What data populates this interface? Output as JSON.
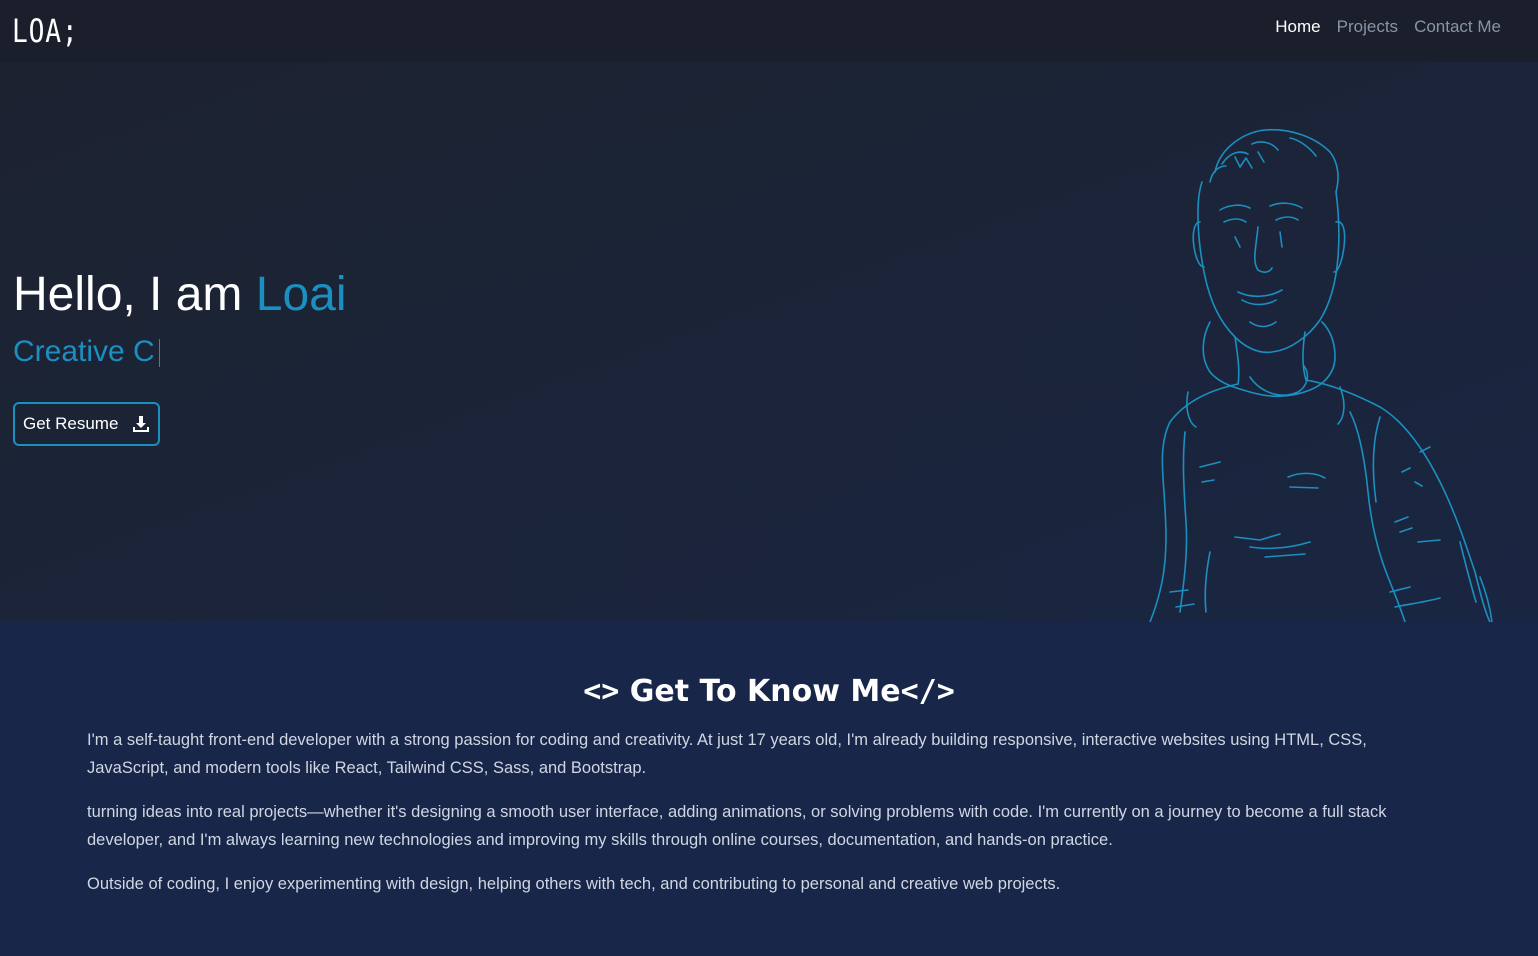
{
  "navbar": {
    "logo": "LOA;",
    "links": [
      {
        "label": "Home",
        "active": true
      },
      {
        "label": "Projects",
        "active": false
      },
      {
        "label": "Contact Me",
        "active": false
      }
    ]
  },
  "hero": {
    "greeting": "Hello, I am ",
    "name": "Loai",
    "subtitle": "Creative C",
    "resume_button": "Get Resume",
    "resume_icon": "download-icon"
  },
  "about": {
    "title_open": "<>",
    "title": " Get To Know Me",
    "title_close": "</>",
    "paragraphs": [
      "I'm a self-taught front-end developer with a strong passion for coding and creativity. At just 17 years old, I'm already building responsive, interactive websites using HTML, CSS, JavaScript, and modern tools like React, Tailwind CSS, Sass, and Bootstrap.",
      "turning ideas into real projects—whether it's designing a smooth user interface, adding animations, or solving problems with code. I'm currently on a journey to become a full stack developer, and I'm always learning new technologies and improving my skills through online courses, documentation, and hands-on practice.",
      "Outside of coding, I enjoy experimenting with design, helping others with tech, and contributing to personal and creative web projects."
    ]
  },
  "colors": {
    "accent": "#1a8fc0",
    "navbar_bg": "#1a1f2b",
    "about_bg": "#172649"
  }
}
